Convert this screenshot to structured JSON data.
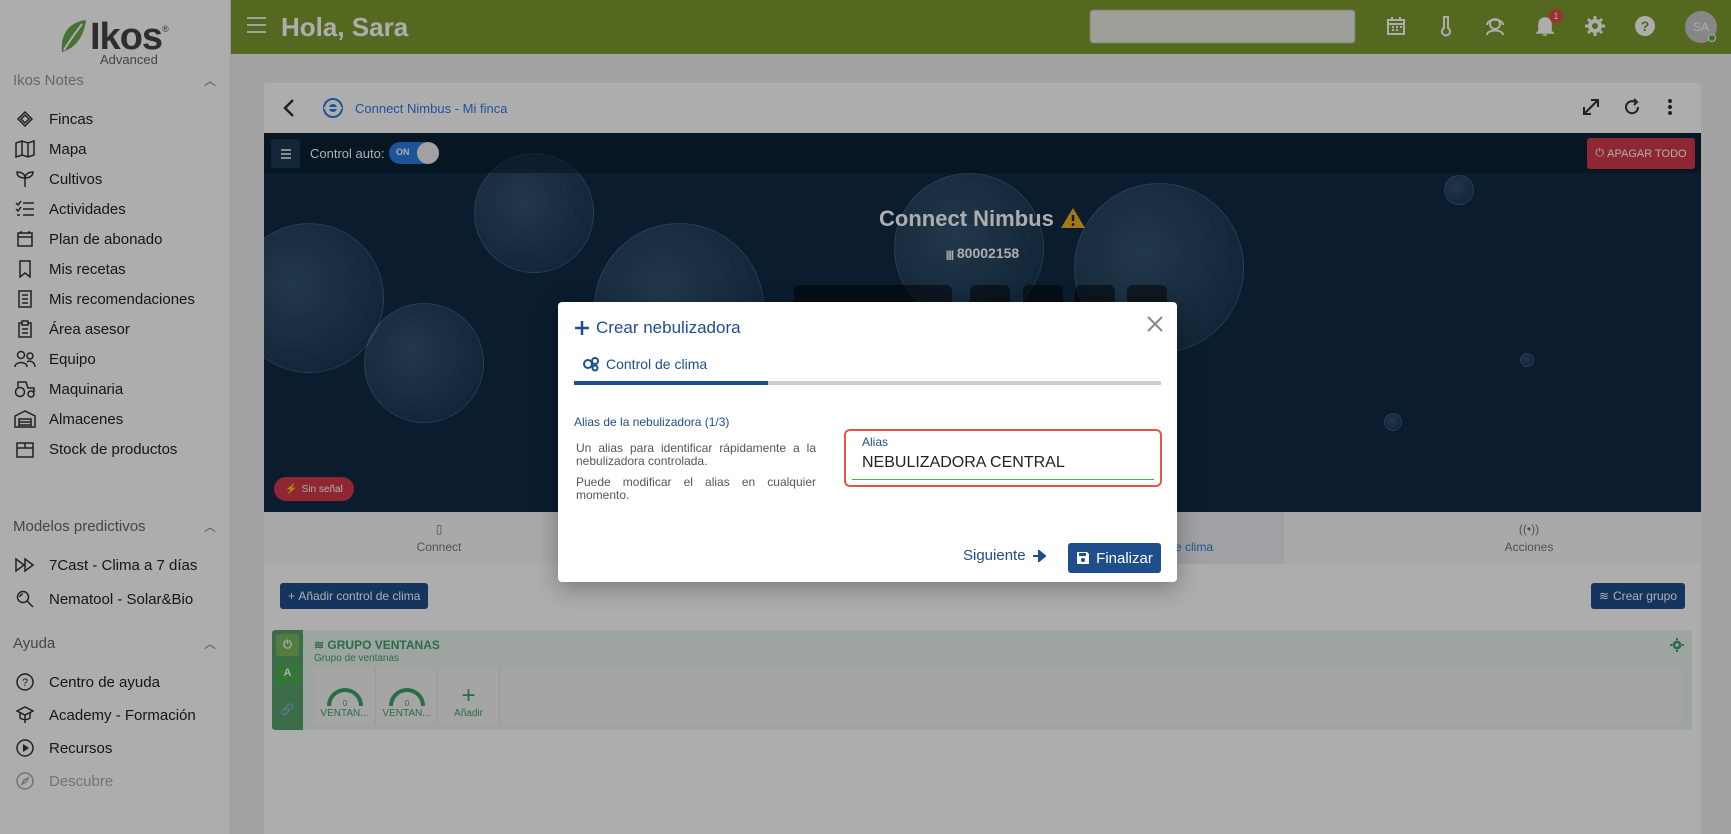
{
  "sidebar": {
    "logo": {
      "brand": "Ikos",
      "sub": "Advanced",
      "reg": "®"
    },
    "sections": [
      {
        "title": "Ikos Notes"
      },
      {
        "title": "Modelos predictivos"
      },
      {
        "title": "Ayuda"
      }
    ],
    "items": [
      {
        "label": "Fincas",
        "icon": "fields-icon"
      },
      {
        "label": "Mapa",
        "icon": "map-icon"
      },
      {
        "label": "Cultivos",
        "icon": "sprout-icon"
      },
      {
        "label": "Actividades",
        "icon": "checklist-icon"
      },
      {
        "label": "Plan de abonado",
        "icon": "calendar-icon"
      },
      {
        "label": "Mis recetas",
        "icon": "bookmark-icon"
      },
      {
        "label": "Mis recomendaciones",
        "icon": "document-list-icon"
      },
      {
        "label": "Área asesor",
        "icon": "clipboard-icon"
      },
      {
        "label": "Equipo",
        "icon": "team-icon"
      },
      {
        "label": "Maquinaria",
        "icon": "tractor-icon"
      },
      {
        "label": "Almacenes",
        "icon": "warehouse-icon"
      },
      {
        "label": "Stock de productos",
        "icon": "box-icon"
      }
    ],
    "predictive": [
      {
        "label": "7Cast - Clima a 7 días",
        "icon": "fast-forward-icon"
      },
      {
        "label": "Nematool - Solar&Bio",
        "icon": "magnifier-icon"
      }
    ],
    "help": [
      {
        "label": "Centro de ayuda",
        "icon": "question-icon"
      },
      {
        "label": "Academy - Formación",
        "icon": "graduation-icon"
      },
      {
        "label": "Recursos",
        "icon": "play-icon"
      },
      {
        "label": "Descubre",
        "icon": "compass-icon"
      }
    ]
  },
  "topbar": {
    "greeting": "Hola, Sara",
    "notifications_count": "1",
    "avatar_initials": "SA",
    "bg_color": "#7c9a2f"
  },
  "device_panel": {
    "title": "Connect Nimbus - Mi finca",
    "control_auto_label": "Control auto:",
    "toggle_label": "ON",
    "apagar_todo": "APAGAR TODO",
    "device_name": "Connect Nimbus",
    "device_id": "80002158",
    "sin_senal": "Sin señal"
  },
  "tabs": [
    {
      "label": "Connect",
      "icon": "device-icon"
    },
    {
      "label": "e clima",
      "icon": "climate-icon"
    },
    {
      "label": "Acciones",
      "icon": "broadcast-icon"
    }
  ],
  "actions": {
    "add_climate": "Añadir control de clima",
    "create_group": "Crear grupo"
  },
  "group": {
    "title": "GRUPO VENTANAS",
    "subtitle": "Grupo de ventanas",
    "side_letter": "A",
    "items": [
      {
        "label": "VENTAN...",
        "value": "0"
      },
      {
        "label": "VENTAN...",
        "value": "0"
      }
    ],
    "add_label": "Añadir"
  },
  "dialog": {
    "title": "Crear nebulizadora",
    "tab": "Control de clima",
    "progress_fraction": 0.33,
    "step_title": "Alias de la nebulizadora (1/3)",
    "desc_1": "Un alias para identificar rápidamente a la nebulizadora controlada.",
    "desc_2": "Puede modificar el alias en cualquier momento.",
    "alias_label": "Alias",
    "alias_value": "NEBULIZADORA CENTRAL",
    "next_label": "Siguiente",
    "finish_label": "Finalizar"
  }
}
